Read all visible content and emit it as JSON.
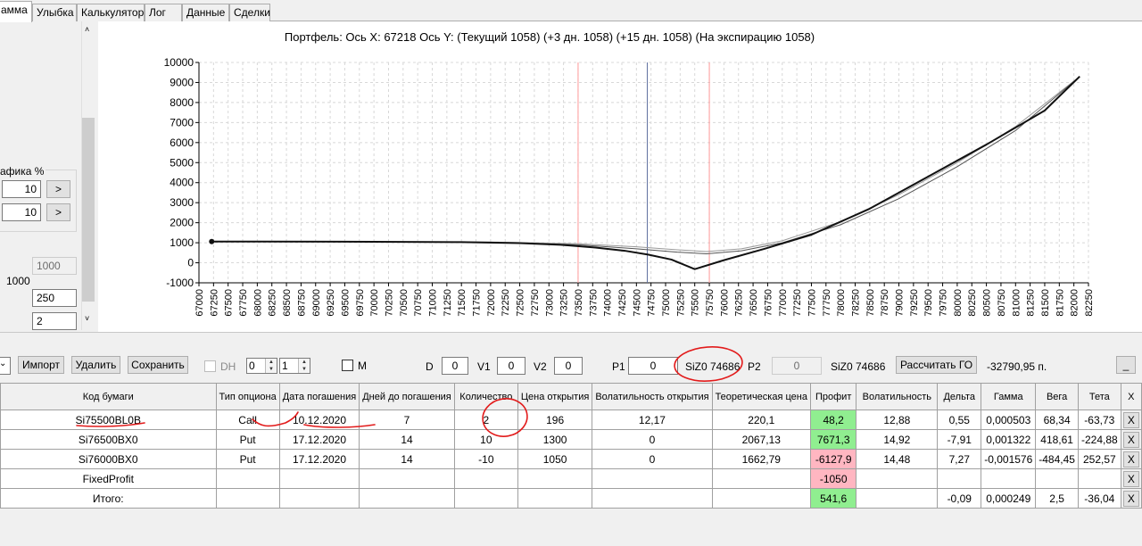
{
  "tabs": [
    "амма",
    "Улыбка",
    "Калькулятор",
    "Лог",
    "Данные",
    "Сделки"
  ],
  "left": {
    "section_label": "афика %",
    "field1": "10",
    "field2": "10",
    "step_button": ">",
    "val_disabled": "1000",
    "side_label": "1000",
    "val_250": "250",
    "val_2": "2"
  },
  "chart_data": {
    "type": "line",
    "title": "Портфель: Ось X: 67218 Ось Y:  (Текущий 1058)  (+3 дн. 1058)  (+15 дн. 1058)  (На экспирацию 1058)",
    "ylim": [
      -1000,
      10000
    ],
    "yticks": [
      -1000,
      0,
      1000,
      2000,
      3000,
      4000,
      5000,
      6000,
      7000,
      8000,
      9000,
      10000
    ],
    "xlim": [
      67000,
      82250
    ],
    "xticks": [
      67000,
      67250,
      67500,
      67750,
      68000,
      68250,
      68500,
      68750,
      69000,
      69250,
      69500,
      69750,
      70000,
      70250,
      70500,
      70750,
      71000,
      71250,
      71500,
      71750,
      72000,
      72250,
      72500,
      72750,
      73000,
      73250,
      73500,
      73750,
      74000,
      74250,
      74500,
      74750,
      75000,
      75250,
      75500,
      75750,
      76000,
      76250,
      76500,
      76750,
      77000,
      77250,
      77500,
      77750,
      78000,
      78250,
      78500,
      78750,
      79000,
      79250,
      79500,
      79750,
      80000,
      80250,
      80500,
      80750,
      81000,
      81250,
      81500,
      81750,
      82000,
      82250
    ],
    "vlines": [
      {
        "x": 73500,
        "color": "#ff9999"
      },
      {
        "x": 74686,
        "color": "#6070a0"
      },
      {
        "x": 75750,
        "color": "#ff9999"
      }
    ],
    "marker": {
      "x": 67218,
      "y": 1058
    },
    "series": [
      {
        "x": [
          67218,
          68000,
          70000,
          71500,
          72500,
          73200,
          73800,
          74300,
          74700,
          75100,
          75500,
          76000,
          76700,
          77500,
          78500,
          79500,
          80500,
          81500,
          82100
        ],
        "y": [
          1058,
          1058,
          1050,
          1030,
          980,
          900,
          760,
          600,
          410,
          160,
          -320,
          130,
          700,
          1400,
          2700,
          4300,
          5900,
          7600,
          9300
        ],
        "color": "#111111",
        "width": 2
      },
      {
        "x": [
          67218,
          70000,
          72000,
          73500,
          74500,
          75200,
          75700,
          76300,
          77000,
          78000,
          79000,
          80000,
          81000,
          82100
        ],
        "y": [
          1058,
          1050,
          1020,
          900,
          700,
          530,
          450,
          600,
          1000,
          1900,
          3200,
          4800,
          6600,
          9300
        ],
        "color": "#555555",
        "width": 1
      },
      {
        "x": [
          67218,
          70000,
          72000,
          73500,
          74500,
          75200,
          75700,
          76300,
          77000,
          78000,
          79000,
          80000,
          81000,
          82100
        ],
        "y": [
          1058,
          1055,
          1040,
          950,
          800,
          650,
          560,
          700,
          1100,
          2050,
          3400,
          5000,
          6800,
          9300
        ],
        "color": "#999999",
        "width": 1
      }
    ]
  },
  "toolbar": {
    "import": "Импорт",
    "delete": "Удалить",
    "save": "Сохранить",
    "dh": "DH",
    "spin1": "0",
    "spin2": "1",
    "m": "M",
    "d": "D",
    "d_val": "0",
    "v1": "V1",
    "v1_val": "0",
    "v2": "V2",
    "v2_val": "0",
    "p1": "P1",
    "p1_val": "0",
    "p1_instrument": "SiZ0 74686",
    "p2": "P2",
    "p2_val": "0",
    "p2_instrument": "SiZ0 74686",
    "calc_go": "Рассчитать ГО",
    "go_value": "-32790,95 п.",
    "minimize": "_"
  },
  "table": {
    "headers": [
      "Код бумаги",
      "Тип опциона",
      "Дата погашения",
      "Дней до погашения",
      "Количество",
      "Цена открытия",
      "Волатильность открытия",
      "Теоретическая цена",
      "Профит",
      "Волатильность",
      "Дельта",
      "Гамма",
      "Вега",
      "Тета",
      "X"
    ],
    "rows": [
      [
        "Si75500BL0B",
        "Call",
        "10.12.2020",
        "7",
        "2",
        "196",
        "12,17",
        "220,1",
        "48,2",
        "12,88",
        "0,55",
        "0,000503",
        "68,34",
        "-63,73",
        "X"
      ],
      [
        "Si76500BX0",
        "Put",
        "17.12.2020",
        "14",
        "10",
        "1300",
        "0",
        "2067,13",
        "7671,3",
        "14,92",
        "-7,91",
        "0,001322",
        "418,61",
        "-224,88",
        "X"
      ],
      [
        "Si76000BX0",
        "Put",
        "17.12.2020",
        "14",
        "-10",
        "1050",
        "0",
        "1662,79",
        "-6127,9",
        "14,48",
        "7,27",
        "-0,001576",
        "-484,45",
        "252,57",
        "X"
      ],
      [
        "FixedProfit",
        "",
        "",
        "",
        "",
        "",
        "",
        "",
        "-1050",
        "",
        "",
        "",
        "",
        "",
        "X"
      ],
      [
        "Итого:",
        "",
        "",
        "",
        "",
        "",
        "",
        "",
        "541,6",
        "",
        "-0,09",
        "0,000249",
        "2,5",
        "-36,04",
        "X"
      ]
    ],
    "profit_colors": [
      "green",
      "green",
      "pink",
      "pink",
      "green"
    ]
  }
}
